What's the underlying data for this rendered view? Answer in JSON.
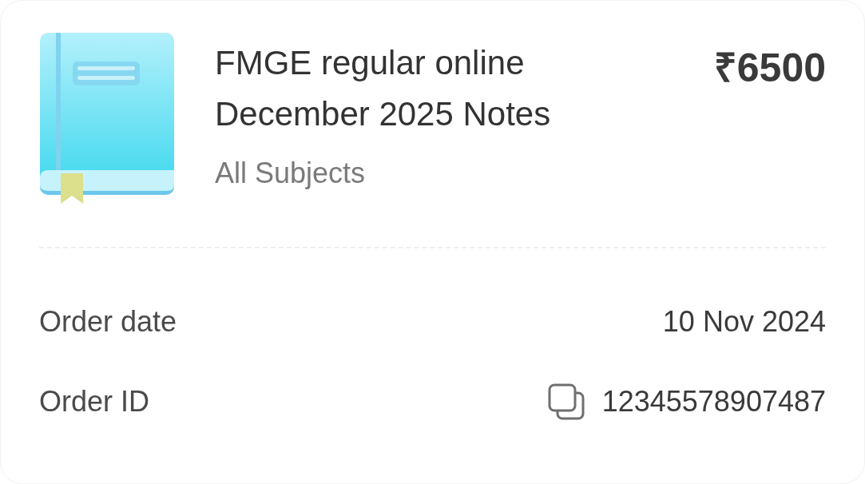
{
  "order": {
    "product": {
      "title": "FMGE regular online December 2025 Notes",
      "subtitle": "All Subjects",
      "price": "₹6500"
    },
    "details": [
      {
        "kind": "text",
        "label": "Order date",
        "value": "10 Nov 2024"
      },
      {
        "kind": "copyable",
        "label": "Order ID",
        "value": "12345578907487"
      }
    ]
  }
}
